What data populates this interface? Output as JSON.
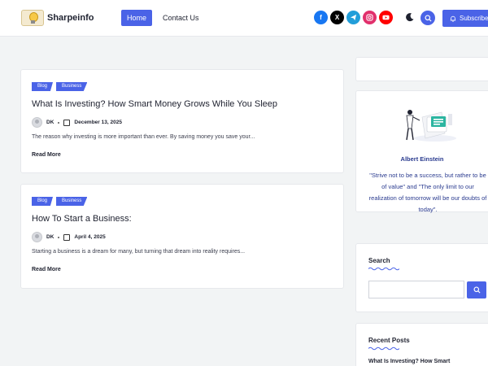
{
  "header": {
    "site_name": "Sharpeinfo",
    "nav": [
      {
        "label": "Home",
        "active": true
      },
      {
        "label": "Contact Us",
        "active": false
      }
    ],
    "socials": [
      {
        "name": "facebook-icon",
        "glyph": "f",
        "color": "#1877f2"
      },
      {
        "name": "x-icon",
        "glyph": "𝕏",
        "color": "#000000"
      },
      {
        "name": "telegram-icon",
        "glyph": "➤",
        "color": "#229ed9"
      },
      {
        "name": "instagram-icon",
        "glyph": "◎",
        "color": "#e1306c"
      },
      {
        "name": "youtube-icon",
        "glyph": "▶",
        "color": "#ff0000"
      }
    ],
    "subscribe_label": "Subscribe"
  },
  "posts": [
    {
      "tags": [
        "Blog",
        "Business"
      ],
      "title": "What Is Investing? How Smart Money Grows While You Sleep",
      "author": "DK",
      "date": "December 13, 2025",
      "excerpt": "The reason why investing is more important than ever. By saving money you save your...",
      "read_more": "Read More"
    },
    {
      "tags": [
        "Blog",
        "Business"
      ],
      "title": "How To Start a Business:",
      "author": "DK",
      "date": "April 4, 2025",
      "excerpt": "Starting a business is a dream for many, but turning that dream into reality requires...",
      "read_more": "Read More"
    }
  ],
  "sidebar": {
    "quote": {
      "author": "Albert Einstein",
      "text": "\"Strive not to be a success, but rather to be of value\" and \"The only limit to our realization of tomorrow will be our doubts of today\"."
    },
    "search": {
      "title": "Search",
      "placeholder": ""
    },
    "recent": {
      "title": "Recent Posts",
      "items": [
        "What Is Investing? How Smart"
      ]
    }
  },
  "colors": {
    "accent": "#4a63e7",
    "background": "#f2f4f5"
  }
}
